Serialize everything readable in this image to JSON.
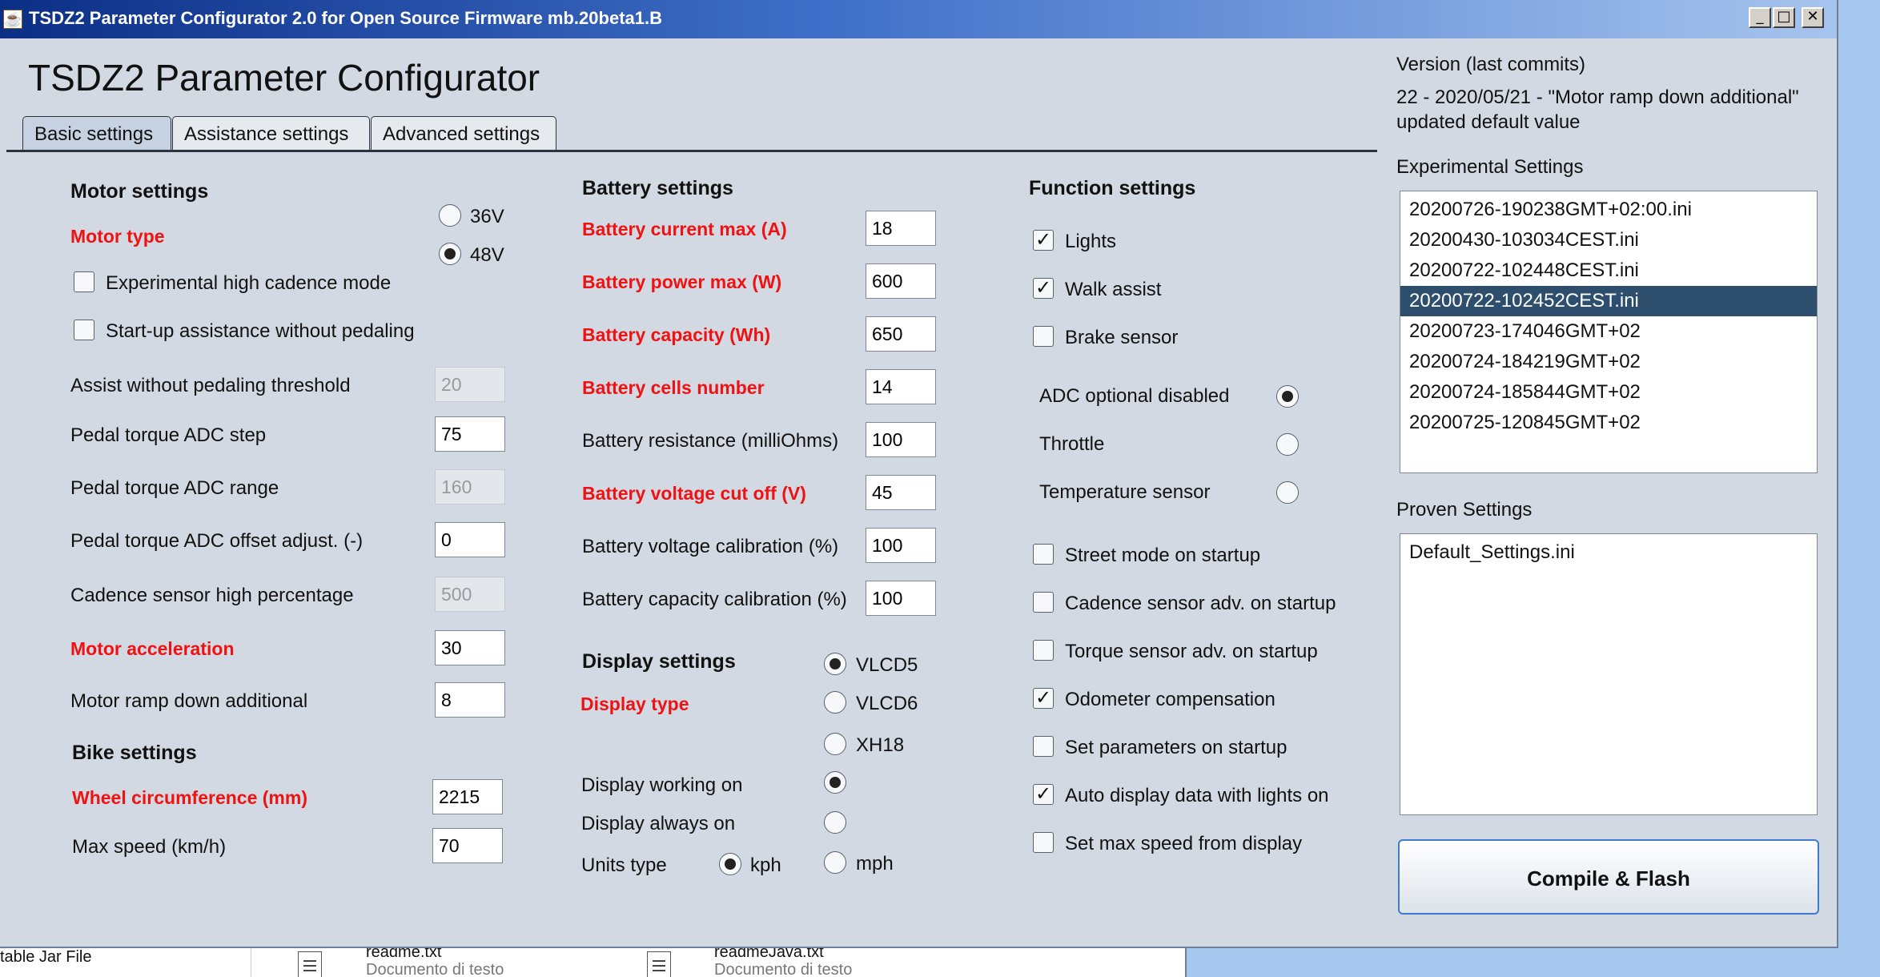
{
  "window": {
    "title": "TSDZ2 Parameter Configurator 2.0 for Open Source Firmware mb.20beta1.B"
  },
  "app": {
    "heading": "TSDZ2 Parameter Configurator"
  },
  "tabs": [
    "Basic settings",
    "Assistance settings",
    "Advanced settings"
  ],
  "motor": {
    "header": "Motor settings",
    "type_label": "Motor type",
    "opt_36v": "36V",
    "opt_48v": "48V",
    "selected": "48V",
    "high_cadence": {
      "label": "Experimental high cadence mode",
      "checked": false
    },
    "startup_assist": {
      "label": "Start-up assistance without pedaling",
      "checked": false
    },
    "threshold": {
      "label": "Assist without pedaling threshold",
      "value": "20"
    },
    "adc_step": {
      "label": "Pedal torque ADC step",
      "value": "75"
    },
    "adc_range": {
      "label": "Pedal torque ADC range",
      "value": "160"
    },
    "adc_offset": {
      "label": " Pedal torque ADC offset adjust. (-)",
      "value": "0"
    },
    "cadence_high": {
      "label": "Cadence sensor high percentage",
      "value": "500"
    },
    "accel": {
      "label": "Motor acceleration",
      "value": "30"
    },
    "ramp": {
      "label": "Motor ramp down additional",
      "value": "8"
    }
  },
  "bike": {
    "header": "Bike settings",
    "wheel": {
      "label": "Wheel circumference (mm)",
      "value": "2215"
    },
    "maxspeed": {
      "label": "Max speed (km/h)",
      "value": "70"
    }
  },
  "battery": {
    "header": "Battery settings",
    "current": {
      "label": "Battery current max (A)",
      "value": "18"
    },
    "power": {
      "label": "Battery power max (W)",
      "value": "600"
    },
    "capacity": {
      "label": "Battery capacity (Wh)",
      "value": "650"
    },
    "cells": {
      "label": "Battery cells number",
      "value": "14"
    },
    "resistance": {
      "label": "Battery resistance (milliOhms)",
      "value": "100"
    },
    "cutoff": {
      "label": "Battery voltage cut off (V)",
      "value": "45"
    },
    "vcal": {
      "label": "Battery voltage calibration (%)",
      "value": "100"
    },
    "ccal": {
      "label": "Battery capacity calibration (%)",
      "value": "100"
    }
  },
  "display": {
    "header": "Display settings",
    "type_label": "Display type",
    "opt_vlcd5": "VLCD5",
    "opt_vlcd6": "VLCD6",
    "opt_xh18": "XH18",
    "selected_type": "VLCD5",
    "working_on": "Display working on",
    "always_on": "Display always on",
    "selected_mode": "working_on",
    "units_label": "Units type",
    "opt_kph": "kph",
    "opt_mph": "mph",
    "selected_units": "kph"
  },
  "function": {
    "header": "Function settings",
    "lights": {
      "label": "Lights",
      "checked": true
    },
    "walk": {
      "label": "Walk assist",
      "checked": true
    },
    "brake": {
      "label": "Brake sensor",
      "checked": false
    },
    "adc_disabled": "ADC optional disabled",
    "throttle": "Throttle",
    "temp": "Temperature sensor",
    "adc_selected": "adc_disabled",
    "street": {
      "label": "Street mode on startup",
      "checked": false
    },
    "cadence_adv": {
      "label": "Cadence sensor adv. on startup",
      "checked": false
    },
    "torque_adv": {
      "label": "Torque sensor adv. on startup",
      "checked": false
    },
    "odometer": {
      "label": "Odometer compensation",
      "checked": true
    },
    "set_params": {
      "label": "Set parameters on startup",
      "checked": false
    },
    "auto_display": {
      "label": "Auto display data with lights on",
      "checked": true
    },
    "max_speed_display": {
      "label": "Set max speed from display",
      "checked": false
    }
  },
  "right": {
    "version_title": "Version (last commits)",
    "version_line1": "22 - 2020/05/21 - \"Motor ramp down additional\"",
    "version_line2": "updated default value",
    "experimental_title": "Experimental Settings",
    "experimental_items": [
      "20200726-190238GMT+02:00.ini",
      "20200430-103034CEST.ini",
      "20200722-102448CEST.ini",
      "20200722-102452CEST.ini",
      "20200723-174046GMT+02",
      "20200724-184219GMT+02",
      "20200724-185844GMT+02",
      "20200725-120845GMT+02"
    ],
    "experimental_selected": "20200722-102452CEST.ini",
    "proven_title": "Proven Settings",
    "proven_items": [
      "Default_Settings.ini"
    ],
    "compile_button": "Compile & Flash"
  },
  "background": {
    "item_left": "table Jar File",
    "file1_name": "readme.txt",
    "file1_type": "Documento di testo",
    "file2_name": "readmeJava.txt",
    "file2_type": "Documento di testo"
  }
}
